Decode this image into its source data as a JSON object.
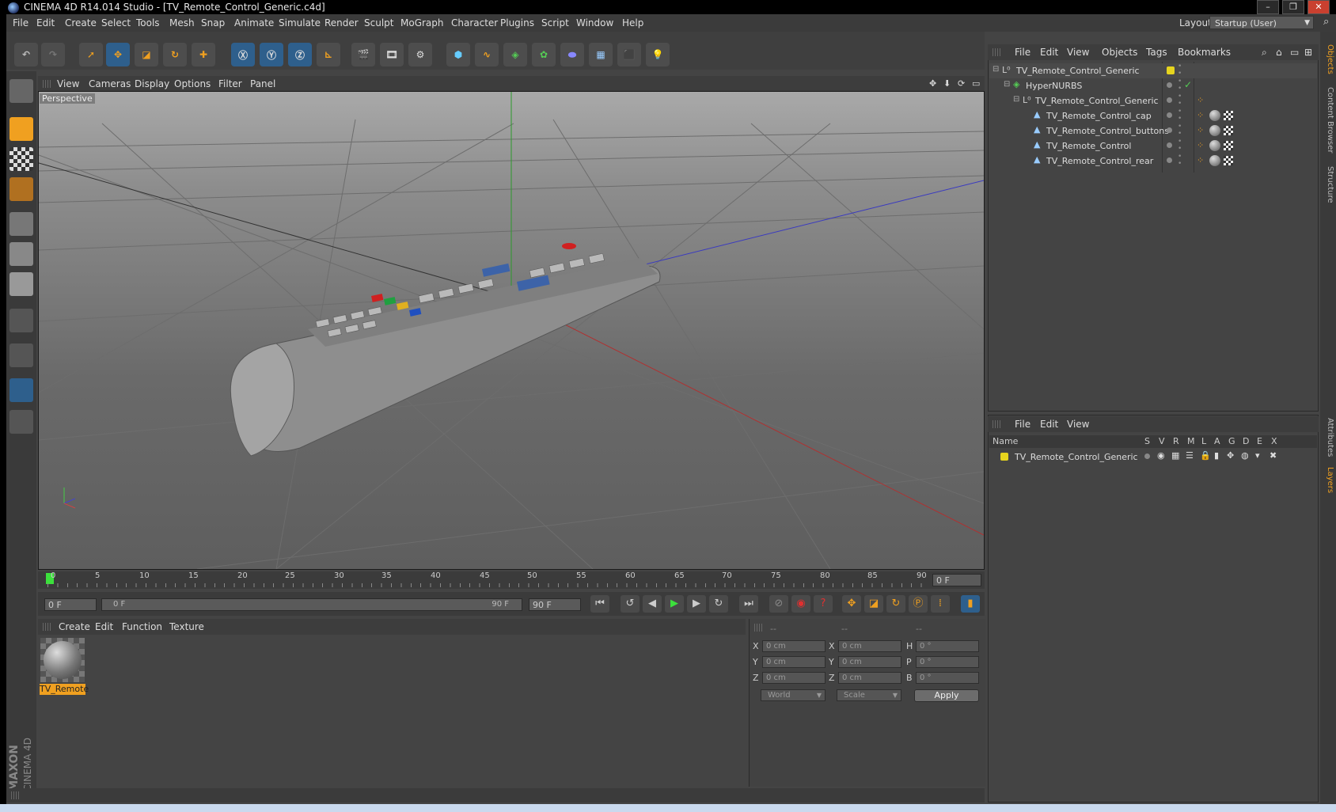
{
  "window": {
    "title": "CINEMA 4D R14.014 Studio - [TV_Remote_Control_Generic.c4d]"
  },
  "menubar": {
    "items": [
      "File",
      "Edit",
      "Create",
      "Select",
      "Tools",
      "Mesh",
      "Snap",
      "Animate",
      "Simulate",
      "Render",
      "Sculpt",
      "MoGraph",
      "Character",
      "Plugins",
      "Script",
      "Window",
      "Help"
    ],
    "layout_label": "Layout:",
    "layout_value": "Startup (User)"
  },
  "viewport": {
    "menu": [
      "View",
      "Cameras",
      "Display",
      "Options",
      "Filter",
      "Panel"
    ],
    "label": "Perspective"
  },
  "timeline": {
    "ticks": [
      "0",
      "5",
      "10",
      "15",
      "20",
      "25",
      "30",
      "35",
      "40",
      "45",
      "50",
      "55",
      "60",
      "65",
      "70",
      "75",
      "80",
      "85",
      "90"
    ],
    "current_frame": "0 F"
  },
  "transport": {
    "start_field": "0 F",
    "range_start": "0 F",
    "range_end": "90 F",
    "end_field": "90 F"
  },
  "materials": {
    "menu": [
      "Create",
      "Edit",
      "Function",
      "Texture"
    ],
    "items": [
      {
        "label": "TV_Remote"
      }
    ]
  },
  "coordinates": {
    "headers": [
      "--",
      "--",
      "--"
    ],
    "rows": [
      {
        "a": "X",
        "av": "0 cm",
        "b": "X",
        "bv": "0 cm",
        "c": "H",
        "cv": "0 °"
      },
      {
        "a": "Y",
        "av": "0 cm",
        "b": "Y",
        "bv": "0 cm",
        "c": "P",
        "cv": "0 °"
      },
      {
        "a": "Z",
        "av": "0 cm",
        "b": "Z",
        "bv": "0 cm",
        "c": "B",
        "cv": "0 °"
      }
    ],
    "mode": "World",
    "size_mode": "Scale",
    "apply": "Apply"
  },
  "objects": {
    "menu": [
      "File",
      "Edit",
      "View",
      "Objects",
      "Tags",
      "Bookmarks"
    ],
    "rows": [
      {
        "name": "TV_Remote_Control_Generic",
        "indent": 0
      },
      {
        "name": "HyperNURBS",
        "indent": 1
      },
      {
        "name": "TV_Remote_Control_Generic",
        "indent": 2
      },
      {
        "name": "TV_Remote_Control_cap",
        "indent": 3
      },
      {
        "name": "TV_Remote_Control_buttons",
        "indent": 3
      },
      {
        "name": "TV_Remote_Control",
        "indent": 3
      },
      {
        "name": "TV_Remote_Control_rear",
        "indent": 3
      }
    ]
  },
  "layers": {
    "menu": [
      "File",
      "Edit",
      "View"
    ],
    "columns": [
      "Name",
      "S",
      "V",
      "R",
      "M",
      "L",
      "A",
      "G",
      "D",
      "E",
      "X"
    ],
    "rows": [
      {
        "name": "TV_Remote_Control_Generic"
      }
    ]
  },
  "side_tabs": [
    "Objects",
    "Content Browser",
    "Structure",
    "Attributes",
    "Layers"
  ],
  "brand": {
    "line1": "MAXON",
    "line2": "CINEMA 4D"
  },
  "colors": {
    "accent": "#f0a020",
    "selection": "#2e5f8c",
    "layer": "#e6d41e"
  }
}
